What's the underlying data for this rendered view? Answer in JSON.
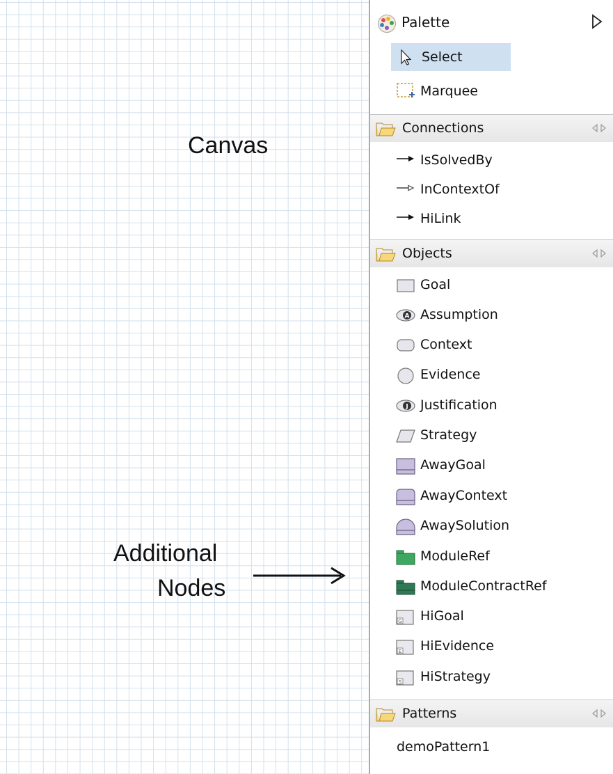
{
  "canvas": {
    "label": "Canvas",
    "annotation_line1": "Additional",
    "annotation_line2": "Nodes"
  },
  "palette": {
    "title": "Palette",
    "tools": [
      {
        "label": "Select",
        "icon": "arrow-pointer-icon",
        "selected": true
      },
      {
        "label": "Marquee",
        "icon": "marquee-icon"
      }
    ],
    "drawers": [
      {
        "label": "Connections",
        "items": [
          {
            "label": "IsSolvedBy",
            "icon": "solid-arrow-icon"
          },
          {
            "label": "InContextOf",
            "icon": "hollow-arrow-icon"
          },
          {
            "label": "HiLink",
            "icon": "solid-arrow-icon"
          }
        ]
      },
      {
        "label": "Objects",
        "items": [
          {
            "label": "Goal",
            "icon": "rectangle-icon"
          },
          {
            "label": "Assumption",
            "icon": "assumption-oval-icon"
          },
          {
            "label": "Context",
            "icon": "rounded-rectangle-icon"
          },
          {
            "label": "Evidence",
            "icon": "circle-icon"
          },
          {
            "label": "Justification",
            "icon": "justification-oval-icon"
          },
          {
            "label": "Strategy",
            "icon": "parallelogram-icon"
          },
          {
            "label": "AwayGoal",
            "icon": "away-goal-icon"
          },
          {
            "label": "AwayContext",
            "icon": "away-context-icon"
          },
          {
            "label": "AwaySolution",
            "icon": "away-solution-icon"
          },
          {
            "label": "ModuleRef",
            "icon": "module-ref-icon"
          },
          {
            "label": "ModuleContractRef",
            "icon": "module-contract-ref-icon"
          },
          {
            "label": "HiGoal",
            "icon": "hi-goal-icon",
            "badge": "G"
          },
          {
            "label": "HiEvidence",
            "icon": "hi-evidence-icon",
            "badge": "E"
          },
          {
            "label": "HiStrategy",
            "icon": "hi-strategy-icon",
            "badge": "S"
          }
        ]
      },
      {
        "label": "Patterns",
        "items": [
          {
            "label": "demoPattern1"
          }
        ]
      }
    ]
  },
  "colors": {
    "grid": "#d2e0ec",
    "selection": "#cfe0f1",
    "away_fill": "#c8bedf",
    "module_fill": "#3ea860"
  }
}
